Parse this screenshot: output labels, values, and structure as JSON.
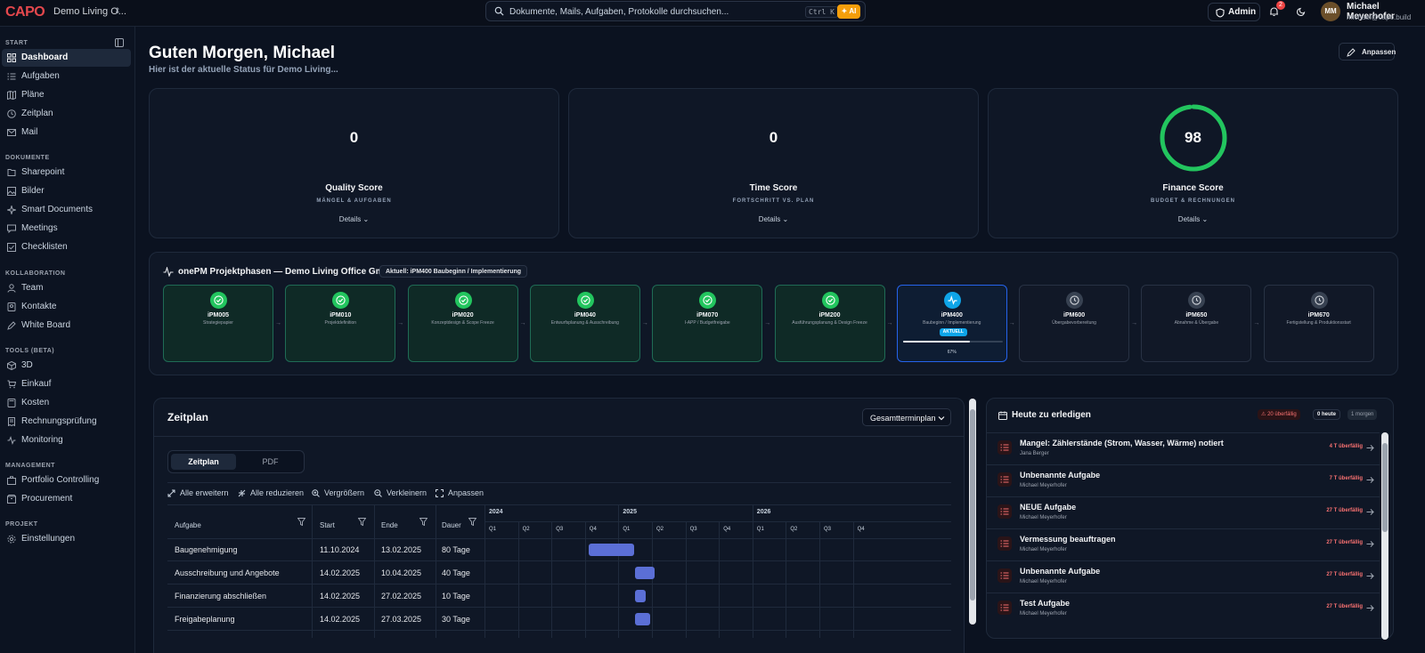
{
  "app": {
    "logo": "CAPO",
    "project": "Demo Living O...",
    "search_placeholder": "Dokumente, Mails, Aufgaben, Protokolle durchsuchen...",
    "search_shortcut": "Ctrl K",
    "ai_label": "AI",
    "admin_label": "Admin",
    "notifications": "2",
    "user_initials": "MM",
    "user_name": "Michael Meyerhofer",
    "user_email": "michael@capo.build"
  },
  "sidebar": {
    "sections": [
      {
        "label": "START",
        "items": [
          {
            "label": "Dashboard",
            "icon": "dashboard-icon",
            "active": true
          },
          {
            "label": "Aufgaben",
            "icon": "tasks-icon"
          },
          {
            "label": "Pläne",
            "icon": "map-icon"
          },
          {
            "label": "Zeitplan",
            "icon": "clock-icon"
          },
          {
            "label": "Mail",
            "icon": "mail-icon"
          }
        ]
      },
      {
        "label": "DOKUMENTE",
        "items": [
          {
            "label": "Sharepoint",
            "icon": "share-icon"
          },
          {
            "label": "Bilder",
            "icon": "image-icon"
          },
          {
            "label": "Smart Documents",
            "icon": "sparkle-icon"
          },
          {
            "label": "Meetings",
            "icon": "chat-icon"
          },
          {
            "label": "Checklisten",
            "icon": "checklist-icon"
          }
        ]
      },
      {
        "label": "KOLLABORATION",
        "items": [
          {
            "label": "Team",
            "icon": "user-icon"
          },
          {
            "label": "Kontakte",
            "icon": "contacts-icon"
          },
          {
            "label": "White Board",
            "icon": "pen-icon"
          }
        ]
      },
      {
        "label": "TOOLS (BETA)",
        "items": [
          {
            "label": "3D",
            "icon": "cube-icon"
          },
          {
            "label": "Einkauf",
            "icon": "cart-icon"
          },
          {
            "label": "Kosten",
            "icon": "calculator-icon"
          },
          {
            "label": "Rechnungsprüfung",
            "icon": "invoice-icon"
          },
          {
            "label": "Monitoring",
            "icon": "activity-icon"
          }
        ]
      },
      {
        "label": "MANAGEMENT",
        "items": [
          {
            "label": "Portfolio Controlling",
            "icon": "briefcase-icon"
          },
          {
            "label": "Procurement",
            "icon": "box-icon"
          }
        ]
      },
      {
        "label": "PROJEKT",
        "items": [
          {
            "label": "Einstellungen",
            "icon": "gear-icon"
          }
        ]
      }
    ]
  },
  "header": {
    "greeting": "Guten Morgen, Michael",
    "subtitle": "Hier ist der aktuelle Status für Demo Living...",
    "customize_label": "Anpassen"
  },
  "scores": [
    {
      "value": "0",
      "title": "Quality Score",
      "subtitle": "MÄNGEL & AUFGABEN",
      "details": "Details"
    },
    {
      "value": "0",
      "title": "Time Score",
      "subtitle": "FORTSCHRITT VS. PLAN",
      "details": "Details"
    },
    {
      "value": "98",
      "title": "Finance Score",
      "subtitle": "BUDGET & RECHNUNGEN",
      "details": "Details",
      "ring_fraction": 0.98,
      "ring_color": "#22c55e"
    }
  ],
  "phases": {
    "title": "onePM Projektphasen — Demo Living Office GmbH",
    "current_label": "Aktuell: iPM400 Baubeginn / Implementierung",
    "items": [
      {
        "code": "iPM005",
        "name": "Strategiepapier",
        "state": "done"
      },
      {
        "code": "iPM010",
        "name": "Projektdefinition",
        "state": "done"
      },
      {
        "code": "iPM020",
        "name": "Konzeptdesign & Scope Freeze",
        "state": "done"
      },
      {
        "code": "iPM040",
        "name": "Entwurfsplanung & Ausschreibung",
        "state": "done"
      },
      {
        "code": "iPM070",
        "name": "I-APP / Budgetfreigabe",
        "state": "done"
      },
      {
        "code": "iPM200",
        "name": "Ausführungsplanung & Design Freeze",
        "state": "done"
      },
      {
        "code": "iPM400",
        "name": "Baubeginn / Implementierung",
        "state": "current",
        "badge": "AKTUELL",
        "progress": 0.67,
        "progress_label": "67%"
      },
      {
        "code": "iPM600",
        "name": "Übergabevorbereitung",
        "state": "future"
      },
      {
        "code": "iPM650",
        "name": "Abnahme & Übergabe",
        "state": "future"
      },
      {
        "code": "iPM670",
        "name": "Fertigstellung & Produktionsstart",
        "state": "future"
      }
    ]
  },
  "zeitplan": {
    "title": "Zeitplan",
    "dropdown": "Gesamtterminplan",
    "tabs": [
      "Zeitplan",
      "PDF"
    ],
    "tools": [
      "Alle erweitern",
      "Alle reduzieren",
      "Vergrößern",
      "Verkleinern",
      "Anpassen"
    ],
    "columns": [
      "Aufgabe",
      "Start",
      "Ende",
      "Dauer"
    ],
    "years": [
      "2024",
      "2025",
      "2026"
    ],
    "quarters": [
      "Q1",
      "Q2",
      "Q3",
      "Q4",
      "Q1",
      "Q2",
      "Q3",
      "Q4",
      "Q1",
      "Q2",
      "Q3",
      "Q4"
    ],
    "rows": [
      {
        "task": "Baugenehmigung",
        "start": "11.10.2024",
        "end": "13.02.2025",
        "duration": "80 Tage"
      },
      {
        "task": "Ausschreibung und Angebote",
        "start": "14.02.2025",
        "end": "10.04.2025",
        "duration": "40 Tage"
      },
      {
        "task": "Finanzierung abschließen",
        "start": "14.02.2025",
        "end": "27.02.2025",
        "duration": "10 Tage"
      },
      {
        "task": "Freigabeplanung",
        "start": "14.02.2025",
        "end": "27.03.2025",
        "duration": "30 Tage"
      }
    ],
    "bar_color": "#5b6fd6"
  },
  "today": {
    "title": "Heute zu erledigen",
    "overdue_chip": "20 überfällig",
    "today_chip": "0 heute",
    "tomorrow_chip": "1 morgen",
    "tasks": [
      {
        "title": "Mangel: Zählerstände (Strom, Wasser, Wärme) notiert",
        "assignee": "Jana Berger",
        "overdue": "4 T überfällig"
      },
      {
        "title": "Unbenannte Aufgabe",
        "assignee": "Michael Meyerhofer",
        "overdue": "7 T überfällig"
      },
      {
        "title": "NEUE Aufgabe",
        "assignee": "Michael Meyerhofer",
        "overdue": "27 T überfällig"
      },
      {
        "title": "Vermessung beauftragen",
        "assignee": "Michael Meyerhofer",
        "overdue": "27 T überfällig"
      },
      {
        "title": "Unbenannte Aufgabe",
        "assignee": "Michael Meyerhofer",
        "overdue": "27 T überfällig"
      },
      {
        "title": "Test Aufgabe",
        "assignee": "Michael Meyerhofer",
        "overdue": "27 T überfällig"
      }
    ]
  }
}
